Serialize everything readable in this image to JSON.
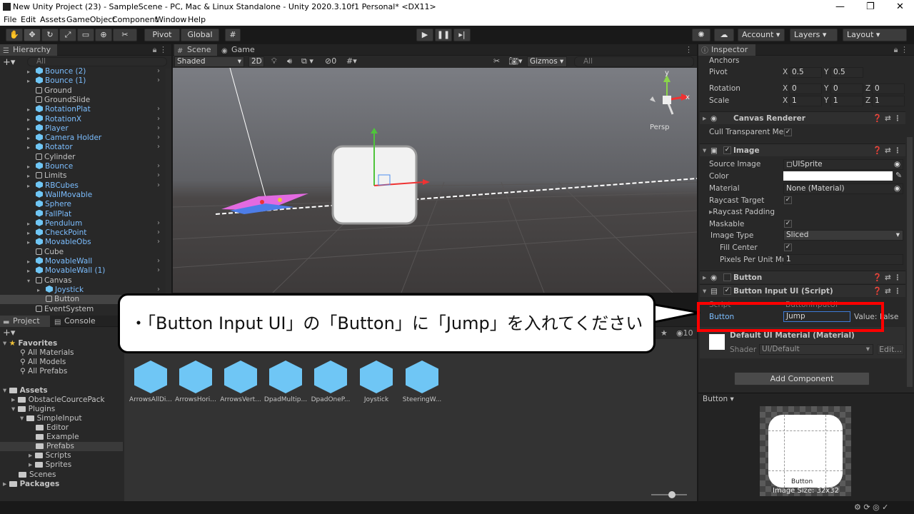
{
  "window": {
    "title": "New Unity Project (23) - SampleScene - PC, Mac & Linux Standalone - Unity 2020.3.10f1 Personal* <DX11>"
  },
  "menu": [
    "File",
    "Edit",
    "Assets",
    "GameObject",
    "Component",
    "Window",
    "Help"
  ],
  "toolbar": {
    "pivot": "Pivot",
    "global": "Global",
    "account": "Account",
    "layers": "Layers",
    "layout": "Layout"
  },
  "hierarchy": {
    "tab": "Hierarchy",
    "search_placeholder": "All",
    "items": [
      {
        "label": "Bounce (2)",
        "prefab": true,
        "expand": true
      },
      {
        "label": "Bounce (1)",
        "prefab": true,
        "expand": true
      },
      {
        "label": "Ground",
        "prefab": false,
        "expand": false
      },
      {
        "label": "GroundSlide",
        "prefab": false,
        "expand": false
      },
      {
        "label": "RotationPlat",
        "prefab": true,
        "expand": true
      },
      {
        "label": "RotationX",
        "prefab": true,
        "expand": true
      },
      {
        "label": "Player",
        "prefab": true,
        "expand": true
      },
      {
        "label": "Camera Holder",
        "prefab": true,
        "expand": true
      },
      {
        "label": "Rotator",
        "prefab": true,
        "expand": true
      },
      {
        "label": "Cylinder",
        "prefab": false,
        "expand": false
      },
      {
        "label": "Bounce",
        "prefab": true,
        "expand": true
      },
      {
        "label": "Limits",
        "prefab": false,
        "expand": true
      },
      {
        "label": "RBCubes",
        "prefab": true,
        "expand": true
      },
      {
        "label": "WallMovable",
        "prefab": true,
        "expand": false
      },
      {
        "label": "Sphere",
        "prefab": true,
        "expand": false
      },
      {
        "label": "FallPlat",
        "prefab": true,
        "expand": false
      },
      {
        "label": "Pendulum",
        "prefab": true,
        "expand": true
      },
      {
        "label": "CheckPoint",
        "prefab": true,
        "expand": true
      },
      {
        "label": "MovableObs",
        "prefab": true,
        "expand": true
      },
      {
        "label": "Cube",
        "prefab": false,
        "expand": false
      },
      {
        "label": "MovableWall",
        "prefab": true,
        "expand": true
      },
      {
        "label": "MovableWall (1)",
        "prefab": true,
        "expand": true
      },
      {
        "label": "Canvas",
        "prefab": false,
        "expand": false
      },
      {
        "label": "Joystick",
        "prefab": true,
        "expand": true
      },
      {
        "label": "Button",
        "prefab": false,
        "expand": false
      },
      {
        "label": "EventSystem",
        "prefab": false,
        "expand": false
      }
    ]
  },
  "scene": {
    "tab_scene": "Scene",
    "tab_game": "Game",
    "shading": "Shaded",
    "mode2d": "2D",
    "gizmos": "Gizmos",
    "search_placeholder": "All",
    "persp": "Persp",
    "hidden_count": "0"
  },
  "project": {
    "tab_project": "Project",
    "tab_console": "Console",
    "favorites_label": "Favorites",
    "favorites": [
      "All Materials",
      "All Models",
      "All Prefabs"
    ],
    "assets_label": "Assets",
    "tree": [
      "ObstacleCourcePack",
      "Plugins",
      "SimpleInput",
      "Editor",
      "Example",
      "Prefabs",
      "Scripts",
      "Sprites",
      "Scenes"
    ],
    "packages_label": "Packages",
    "grid": [
      "ArrowsAllDi...",
      "ArrowsHori...",
      "ArrowsVert...",
      "DpadMultip...",
      "DpadOneP...",
      "Joystick",
      "SteeringW..."
    ],
    "count": "10"
  },
  "inspector": {
    "tab": "Inspector",
    "anchors": "Anchors",
    "pivot": {
      "label": "Pivot",
      "x": "0.5",
      "y": "0.5"
    },
    "rotation": {
      "label": "Rotation",
      "x": "0",
      "y": "0",
      "z": "0"
    },
    "scale": {
      "label": "Scale",
      "x": "1",
      "y": "1",
      "z": "1"
    },
    "canvas_renderer": {
      "title": "Canvas Renderer",
      "cull_label": "Cull Transparent Mes"
    },
    "image": {
      "title": "Image",
      "source_label": "Source Image",
      "source_value": "UISprite",
      "color_label": "Color",
      "material_label": "Material",
      "material_value": "None (Material)",
      "raycast_target": "Raycast Target",
      "raycast_padding": "Raycast Padding",
      "maskable": "Maskable",
      "image_type_label": "Image Type",
      "image_type_value": "Sliced",
      "fill_center": "Fill Center",
      "ppu_label": "Pixels Per Unit Mul",
      "ppu_value": "1"
    },
    "button": {
      "title": "Button"
    },
    "button_input": {
      "title": "Button Input UI (Script)",
      "script_label": "Script",
      "script_value": "ButtonInputUI",
      "button_label": "Button",
      "button_value": "Jump",
      "value_label": "Value:",
      "value_value": "False"
    },
    "material": {
      "title": "Default UI Material (Material)",
      "shader_label": "Shader",
      "shader_value": "UI/Default",
      "edit": "Edit..."
    },
    "add_component": "Add Component",
    "preview": {
      "dropdown": "Button",
      "caption": "Button",
      "size": "Image Size: 32x32"
    }
  },
  "callout": {
    "text": "・「Button Input UI」の「Button」に「Jump」を入れてください"
  },
  "colors": {
    "accent": "#7cbeff",
    "highlight": "#ff0000",
    "prefab": "#6fc6f5"
  }
}
